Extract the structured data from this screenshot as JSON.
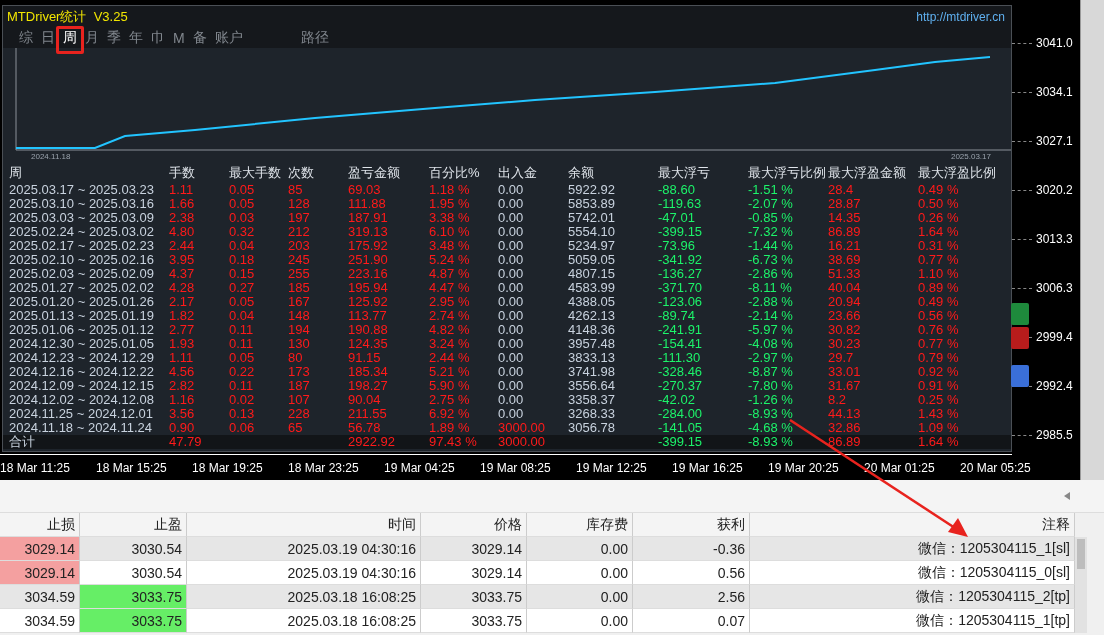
{
  "panel": {
    "title": "MTDriver统计  V3.25",
    "url": "http://mtdriver.cn",
    "tabs": [
      {
        "label": "综",
        "selected": false
      },
      {
        "label": "日",
        "selected": false
      },
      {
        "label": "周",
        "selected": true
      },
      {
        "label": "月",
        "selected": false
      },
      {
        "label": "季",
        "selected": false
      },
      {
        "label": "年",
        "selected": false
      },
      {
        "label": "巾",
        "selected": false
      },
      {
        "label": "M",
        "selected": false
      },
      {
        "label": "备",
        "selected": false
      },
      {
        "label": "账户",
        "selected": false
      },
      {
        "label": "路径",
        "selected": false
      }
    ],
    "chart": {
      "start_label": "2024.11.18",
      "end_label": "2025.03.17"
    },
    "table": {
      "columns": [
        {
          "label": "周",
          "color": "#c8d2de"
        },
        {
          "label": "手数",
          "color": "#ff1a1a"
        },
        {
          "label": "最大手数",
          "color": "#ff1a1a"
        },
        {
          "label": "次数",
          "color": "#ff1a1a"
        },
        {
          "label": "盈亏金额",
          "color": "#ff1a1a"
        },
        {
          "label": "百分比%",
          "color": "#ff1a1a"
        },
        {
          "label": "出入金",
          "color": "#c8d2de"
        },
        {
          "label": "余额",
          "color": "#c8d2de"
        },
        {
          "label": "最大浮亏",
          "color": "#1cf46a"
        },
        {
          "label": "最大浮亏比例",
          "color": "#1cf46a"
        },
        {
          "label": "最大浮盈金额",
          "color": "#ff1a1a"
        },
        {
          "label": "最大浮盈比例",
          "color": "#ff1a1a"
        }
      ],
      "rows": [
        {
          "deposit": false,
          "cells": [
            "2025.03.17 ~ 2025.03.23",
            "1.11",
            "0.05",
            "85",
            "69.03",
            "1.18 %",
            "0.00",
            "5922.92",
            "-88.60",
            "-1.51 %",
            "28.4",
            "0.49 %"
          ]
        },
        {
          "deposit": false,
          "cells": [
            "2025.03.10 ~ 2025.03.16",
            "1.66",
            "0.05",
            "128",
            "111.88",
            "1.95 %",
            "0.00",
            "5853.89",
            "-119.63",
            "-2.07 %",
            "28.87",
            "0.50 %"
          ]
        },
        {
          "deposit": false,
          "cells": [
            "2025.03.03 ~ 2025.03.09",
            "2.38",
            "0.03",
            "197",
            "187.91",
            "3.38 %",
            "0.00",
            "5742.01",
            "-47.01",
            "-0.85 %",
            "14.35",
            "0.26 %"
          ]
        },
        {
          "deposit": false,
          "cells": [
            "2025.02.24 ~ 2025.03.02",
            "4.80",
            "0.32",
            "212",
            "319.13",
            "6.10 %",
            "0.00",
            "5554.10",
            "-399.15",
            "-7.32 %",
            "86.89",
            "1.64 %"
          ]
        },
        {
          "deposit": false,
          "cells": [
            "2025.02.17 ~ 2025.02.23",
            "2.44",
            "0.04",
            "203",
            "175.92",
            "3.48 %",
            "0.00",
            "5234.97",
            "-73.96",
            "-1.44 %",
            "16.21",
            "0.31 %"
          ]
        },
        {
          "deposit": false,
          "cells": [
            "2025.02.10 ~ 2025.02.16",
            "3.95",
            "0.18",
            "245",
            "251.90",
            "5.24 %",
            "0.00",
            "5059.05",
            "-341.92",
            "-6.73 %",
            "38.69",
            "0.77 %"
          ]
        },
        {
          "deposit": false,
          "cells": [
            "2025.02.03 ~ 2025.02.09",
            "4.37",
            "0.15",
            "255",
            "223.16",
            "4.87 %",
            "0.00",
            "4807.15",
            "-136.27",
            "-2.86 %",
            "51.33",
            "1.10 %"
          ]
        },
        {
          "deposit": false,
          "cells": [
            "2025.01.27 ~ 2025.02.02",
            "4.28",
            "0.27",
            "185",
            "195.94",
            "4.47 %",
            "0.00",
            "4583.99",
            "-371.70",
            "-8.11 %",
            "40.04",
            "0.89 %"
          ]
        },
        {
          "deposit": false,
          "cells": [
            "2025.01.20 ~ 2025.01.26",
            "2.17",
            "0.05",
            "167",
            "125.92",
            "2.95 %",
            "0.00",
            "4388.05",
            "-123.06",
            "-2.88 %",
            "20.94",
            "0.49 %"
          ]
        },
        {
          "deposit": false,
          "cells": [
            "2025.01.13 ~ 2025.01.19",
            "1.82",
            "0.04",
            "148",
            "113.77",
            "2.74 %",
            "0.00",
            "4262.13",
            "-89.74",
            "-2.14 %",
            "23.66",
            "0.56 %"
          ]
        },
        {
          "deposit": false,
          "cells": [
            "2025.01.06 ~ 2025.01.12",
            "2.77",
            "0.11",
            "194",
            "190.88",
            "4.82 %",
            "0.00",
            "4148.36",
            "-241.91",
            "-5.97 %",
            "30.82",
            "0.76 %"
          ]
        },
        {
          "deposit": false,
          "cells": [
            "2024.12.30 ~ 2025.01.05",
            "1.93",
            "0.11",
            "130",
            "124.35",
            "3.24 %",
            "0.00",
            "3957.48",
            "-154.41",
            "-4.08 %",
            "30.23",
            "0.77 %"
          ]
        },
        {
          "deposit": false,
          "cells": [
            "2024.12.23 ~ 2024.12.29",
            "1.11",
            "0.05",
            "80",
            "91.15",
            "2.44 %",
            "0.00",
            "3833.13",
            "-111.30",
            "-2.97 %",
            "29.7",
            "0.79 %"
          ]
        },
        {
          "deposit": false,
          "cells": [
            "2024.12.16 ~ 2024.12.22",
            "4.56",
            "0.22",
            "173",
            "185.34",
            "5.21 %",
            "0.00",
            "3741.98",
            "-328.46",
            "-8.87 %",
            "33.01",
            "0.92 %"
          ]
        },
        {
          "deposit": false,
          "cells": [
            "2024.12.09 ~ 2024.12.15",
            "2.82",
            "0.11",
            "187",
            "198.27",
            "5.90 %",
            "0.00",
            "3556.64",
            "-270.37",
            "-7.80 %",
            "31.67",
            "0.91 %"
          ]
        },
        {
          "deposit": false,
          "cells": [
            "2024.12.02 ~ 2024.12.08",
            "1.16",
            "0.02",
            "107",
            "90.04",
            "2.75 %",
            "0.00",
            "3358.37",
            "-42.02",
            "-1.26 %",
            "8.2",
            "0.25 %"
          ]
        },
        {
          "deposit": false,
          "cells": [
            "2024.11.25 ~ 2024.12.01",
            "3.56",
            "0.13",
            "228",
            "211.55",
            "6.92 %",
            "0.00",
            "3268.33",
            "-284.00",
            "-8.93 %",
            "44.13",
            "1.43 %"
          ]
        },
        {
          "deposit": true,
          "cells": [
            "2024.11.18 ~ 2024.11.24",
            "0.90",
            "0.06",
            "65",
            "56.78",
            "1.89 %",
            "3000.00",
            "3056.78",
            "-141.05",
            "-4.68 %",
            "32.86",
            "1.09 %"
          ]
        }
      ],
      "total": {
        "label": "合计",
        "lots": "47.79",
        "profit": "2922.92",
        "percent": "97.43 %",
        "deposit": "3000.00",
        "max_loss": "-399.15",
        "max_loss_ratio": "-8.93 %",
        "max_gain": "86.89",
        "max_gain_ratio": "1.64 %"
      }
    }
  },
  "price_axis": {
    "labels": [
      "3041.0",
      "3034.1",
      "3027.1",
      "3020.2",
      "3013.3",
      "3006.3",
      "2999.4",
      "2992.4",
      "2985.5"
    ]
  },
  "side_buttons": [
    {
      "color": "#1e8a3c"
    },
    {
      "color": "#b81c1c"
    },
    {
      "color": "#3a6fd8"
    }
  ],
  "time_axis": {
    "labels": [
      "18 Mar 11:25",
      "18 Mar 15:25",
      "18 Mar 19:25",
      "18 Mar 23:25",
      "19 Mar 04:25",
      "19 Mar 08:25",
      "19 Mar 12:25",
      "19 Mar 16:25",
      "19 Mar 20:25",
      "20 Mar 01:25",
      "20 Mar 05:25"
    ]
  },
  "orders": {
    "columns": [
      "止损",
      "止盈",
      "时间",
      "价格",
      "库存费",
      "获利",
      "注释"
    ],
    "rows": [
      {
        "sl_hit": true,
        "tp_hit": false,
        "cells": [
          "3029.14",
          "3030.54",
          "2025.03.19 04:30:16",
          "3029.14",
          "0.00",
          "-0.36",
          "微信：1205304115_1[sl]"
        ]
      },
      {
        "sl_hit": true,
        "tp_hit": false,
        "cells": [
          "3029.14",
          "3030.54",
          "2025.03.19 04:30:16",
          "3029.14",
          "0.00",
          "0.56",
          "微信：1205304115_0[sl]"
        ]
      },
      {
        "sl_hit": false,
        "tp_hit": true,
        "cells": [
          "3034.59",
          "3033.75",
          "2025.03.18 16:08:25",
          "3033.75",
          "0.00",
          "2.56",
          "微信：1205304115_2[tp]"
        ]
      },
      {
        "sl_hit": false,
        "tp_hit": true,
        "cells": [
          "3034.59",
          "3033.75",
          "2025.03.18 16:08:25",
          "3033.75",
          "0.00",
          "0.07",
          "微信：1205304115_1[tp]"
        ]
      }
    ]
  },
  "annotations": {
    "highlight_frame": true,
    "arrow": true
  }
}
